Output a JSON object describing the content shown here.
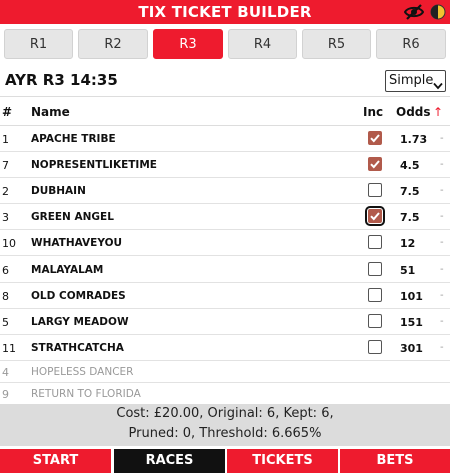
{
  "header": {
    "title": "TIX TICKET BUILDER",
    "icons": [
      "eye-slash-icon",
      "half-circle-theme-icon"
    ]
  },
  "race_tabs": [
    "R1",
    "R2",
    "R3",
    "R4",
    "R5",
    "R6"
  ],
  "active_race_tab": "R3",
  "race": {
    "title": "AYR R3 14:35",
    "mode": "Simple"
  },
  "columns": {
    "num": "#",
    "name": "Name",
    "inc": "Inc",
    "odds": "Odds",
    "sort_arrow": "↑"
  },
  "runners": [
    {
      "num": "1",
      "name": "APACHE TRIBE",
      "included": true,
      "odds": "1.73",
      "extra": "-"
    },
    {
      "num": "7",
      "name": "NOPRESENTLIKETIME",
      "included": true,
      "odds": "4.5",
      "extra": "-"
    },
    {
      "num": "2",
      "name": "DUBHAIN",
      "included": false,
      "odds": "7.5",
      "extra": "-"
    },
    {
      "num": "3",
      "name": "GREEN ANGEL",
      "included": true,
      "odds": "7.5",
      "extra": "-"
    },
    {
      "num": "10",
      "name": "WHATHAVEYOU",
      "included": false,
      "odds": "12",
      "extra": "-"
    },
    {
      "num": "6",
      "name": "MALAYALAM",
      "included": false,
      "odds": "51",
      "extra": "-"
    },
    {
      "num": "8",
      "name": "OLD COMRADES",
      "included": false,
      "odds": "101",
      "extra": "-"
    },
    {
      "num": "5",
      "name": "LARGY MEADOW",
      "included": false,
      "odds": "151",
      "extra": "-"
    },
    {
      "num": "11",
      "name": "STRATHCATCHA",
      "included": false,
      "odds": "301",
      "extra": "-"
    }
  ],
  "scratched": [
    {
      "num": "4",
      "name": "HOPELESS DANCER"
    },
    {
      "num": "9",
      "name": "RETURN TO FLORIDA"
    }
  ],
  "summary": {
    "line1": "Cost: £20.00, Original: 6, Kept: 6,",
    "line2": "Pruned: 0, Threshold: 6.665%"
  },
  "nav": {
    "items": [
      "START",
      "RACES",
      "TICKETS",
      "BETS"
    ],
    "active": "RACES"
  },
  "colors": {
    "brand_red": "#ee1b2e",
    "checked": "#b15a4b",
    "summary_bg": "#dcdcdc",
    "nav_active": "#111111"
  }
}
